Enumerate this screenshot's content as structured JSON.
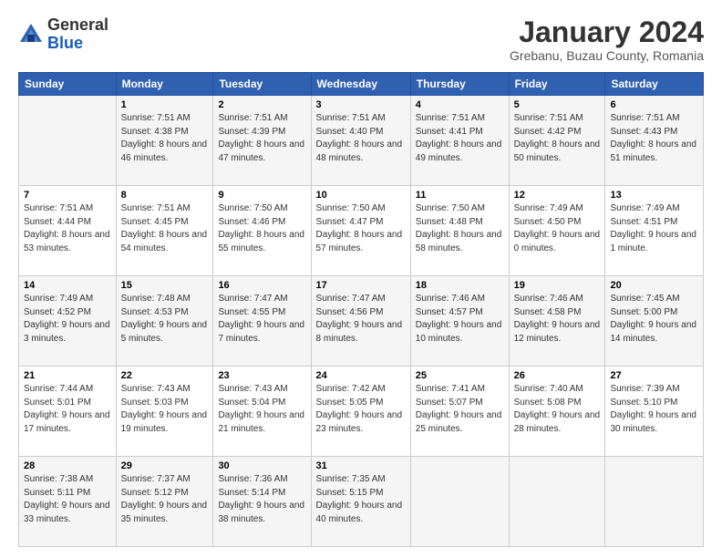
{
  "logo": {
    "general": "General",
    "blue": "Blue"
  },
  "title": "January 2024",
  "location": "Grebanu, Buzau County, Romania",
  "days_header": [
    "Sunday",
    "Monday",
    "Tuesday",
    "Wednesday",
    "Thursday",
    "Friday",
    "Saturday"
  ],
  "weeks": [
    [
      {
        "day": "",
        "sunrise": "",
        "sunset": "",
        "daylight": ""
      },
      {
        "day": "1",
        "sunrise": "Sunrise: 7:51 AM",
        "sunset": "Sunset: 4:38 PM",
        "daylight": "Daylight: 8 hours and 46 minutes."
      },
      {
        "day": "2",
        "sunrise": "Sunrise: 7:51 AM",
        "sunset": "Sunset: 4:39 PM",
        "daylight": "Daylight: 8 hours and 47 minutes."
      },
      {
        "day": "3",
        "sunrise": "Sunrise: 7:51 AM",
        "sunset": "Sunset: 4:40 PM",
        "daylight": "Daylight: 8 hours and 48 minutes."
      },
      {
        "day": "4",
        "sunrise": "Sunrise: 7:51 AM",
        "sunset": "Sunset: 4:41 PM",
        "daylight": "Daylight: 8 hours and 49 minutes."
      },
      {
        "day": "5",
        "sunrise": "Sunrise: 7:51 AM",
        "sunset": "Sunset: 4:42 PM",
        "daylight": "Daylight: 8 hours and 50 minutes."
      },
      {
        "day": "6",
        "sunrise": "Sunrise: 7:51 AM",
        "sunset": "Sunset: 4:43 PM",
        "daylight": "Daylight: 8 hours and 51 minutes."
      }
    ],
    [
      {
        "day": "7",
        "sunrise": "Sunrise: 7:51 AM",
        "sunset": "Sunset: 4:44 PM",
        "daylight": "Daylight: 8 hours and 53 minutes."
      },
      {
        "day": "8",
        "sunrise": "Sunrise: 7:51 AM",
        "sunset": "Sunset: 4:45 PM",
        "daylight": "Daylight: 8 hours and 54 minutes."
      },
      {
        "day": "9",
        "sunrise": "Sunrise: 7:50 AM",
        "sunset": "Sunset: 4:46 PM",
        "daylight": "Daylight: 8 hours and 55 minutes."
      },
      {
        "day": "10",
        "sunrise": "Sunrise: 7:50 AM",
        "sunset": "Sunset: 4:47 PM",
        "daylight": "Daylight: 8 hours and 57 minutes."
      },
      {
        "day": "11",
        "sunrise": "Sunrise: 7:50 AM",
        "sunset": "Sunset: 4:48 PM",
        "daylight": "Daylight: 8 hours and 58 minutes."
      },
      {
        "day": "12",
        "sunrise": "Sunrise: 7:49 AM",
        "sunset": "Sunset: 4:50 PM",
        "daylight": "Daylight: 9 hours and 0 minutes."
      },
      {
        "day": "13",
        "sunrise": "Sunrise: 7:49 AM",
        "sunset": "Sunset: 4:51 PM",
        "daylight": "Daylight: 9 hours and 1 minute."
      }
    ],
    [
      {
        "day": "14",
        "sunrise": "Sunrise: 7:49 AM",
        "sunset": "Sunset: 4:52 PM",
        "daylight": "Daylight: 9 hours and 3 minutes."
      },
      {
        "day": "15",
        "sunrise": "Sunrise: 7:48 AM",
        "sunset": "Sunset: 4:53 PM",
        "daylight": "Daylight: 9 hours and 5 minutes."
      },
      {
        "day": "16",
        "sunrise": "Sunrise: 7:47 AM",
        "sunset": "Sunset: 4:55 PM",
        "daylight": "Daylight: 9 hours and 7 minutes."
      },
      {
        "day": "17",
        "sunrise": "Sunrise: 7:47 AM",
        "sunset": "Sunset: 4:56 PM",
        "daylight": "Daylight: 9 hours and 8 minutes."
      },
      {
        "day": "18",
        "sunrise": "Sunrise: 7:46 AM",
        "sunset": "Sunset: 4:57 PM",
        "daylight": "Daylight: 9 hours and 10 minutes."
      },
      {
        "day": "19",
        "sunrise": "Sunrise: 7:46 AM",
        "sunset": "Sunset: 4:58 PM",
        "daylight": "Daylight: 9 hours and 12 minutes."
      },
      {
        "day": "20",
        "sunrise": "Sunrise: 7:45 AM",
        "sunset": "Sunset: 5:00 PM",
        "daylight": "Daylight: 9 hours and 14 minutes."
      }
    ],
    [
      {
        "day": "21",
        "sunrise": "Sunrise: 7:44 AM",
        "sunset": "Sunset: 5:01 PM",
        "daylight": "Daylight: 9 hours and 17 minutes."
      },
      {
        "day": "22",
        "sunrise": "Sunrise: 7:43 AM",
        "sunset": "Sunset: 5:03 PM",
        "daylight": "Daylight: 9 hours and 19 minutes."
      },
      {
        "day": "23",
        "sunrise": "Sunrise: 7:43 AM",
        "sunset": "Sunset: 5:04 PM",
        "daylight": "Daylight: 9 hours and 21 minutes."
      },
      {
        "day": "24",
        "sunrise": "Sunrise: 7:42 AM",
        "sunset": "Sunset: 5:05 PM",
        "daylight": "Daylight: 9 hours and 23 minutes."
      },
      {
        "day": "25",
        "sunrise": "Sunrise: 7:41 AM",
        "sunset": "Sunset: 5:07 PM",
        "daylight": "Daylight: 9 hours and 25 minutes."
      },
      {
        "day": "26",
        "sunrise": "Sunrise: 7:40 AM",
        "sunset": "Sunset: 5:08 PM",
        "daylight": "Daylight: 9 hours and 28 minutes."
      },
      {
        "day": "27",
        "sunrise": "Sunrise: 7:39 AM",
        "sunset": "Sunset: 5:10 PM",
        "daylight": "Daylight: 9 hours and 30 minutes."
      }
    ],
    [
      {
        "day": "28",
        "sunrise": "Sunrise: 7:38 AM",
        "sunset": "Sunset: 5:11 PM",
        "daylight": "Daylight: 9 hours and 33 minutes."
      },
      {
        "day": "29",
        "sunrise": "Sunrise: 7:37 AM",
        "sunset": "Sunset: 5:12 PM",
        "daylight": "Daylight: 9 hours and 35 minutes."
      },
      {
        "day": "30",
        "sunrise": "Sunrise: 7:36 AM",
        "sunset": "Sunset: 5:14 PM",
        "daylight": "Daylight: 9 hours and 38 minutes."
      },
      {
        "day": "31",
        "sunrise": "Sunrise: 7:35 AM",
        "sunset": "Sunset: 5:15 PM",
        "daylight": "Daylight: 9 hours and 40 minutes."
      },
      {
        "day": "",
        "sunrise": "",
        "sunset": "",
        "daylight": ""
      },
      {
        "day": "",
        "sunrise": "",
        "sunset": "",
        "daylight": ""
      },
      {
        "day": "",
        "sunrise": "",
        "sunset": "",
        "daylight": ""
      }
    ]
  ]
}
